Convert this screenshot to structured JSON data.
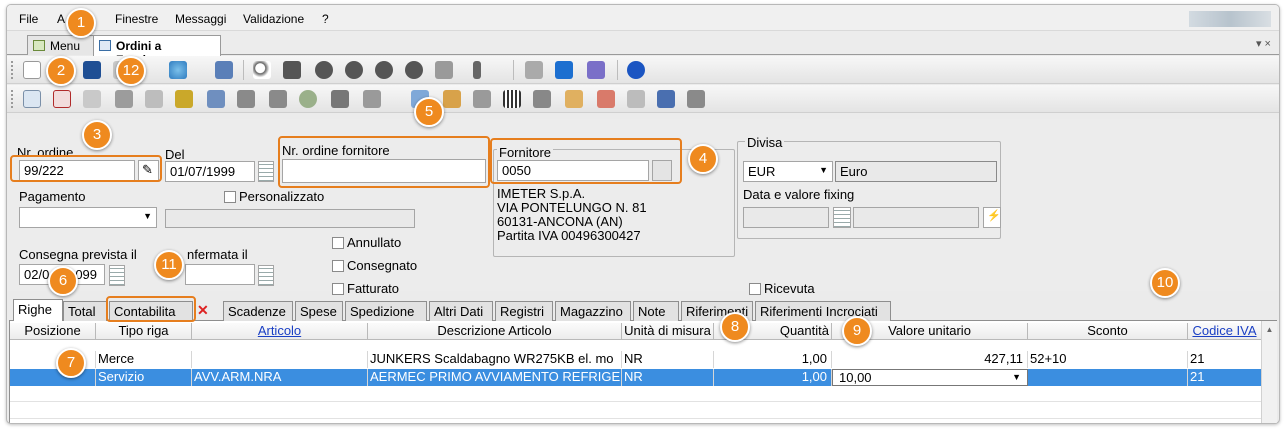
{
  "menu": {
    "file": "File",
    "a": "A",
    "finestre": "Finestre",
    "messaggi": "Messaggi",
    "validazione": "Validazione",
    "help": "?"
  },
  "tabs": {
    "menu": "Menu",
    "ordini": "Ordini a Fornitore"
  },
  "window_controls": "▾ ×",
  "badges": [
    "1",
    "2",
    "3",
    "4",
    "5",
    "6",
    "7",
    "8",
    "9",
    "10",
    "11",
    "12"
  ],
  "form": {
    "nr_ordine_label": "Nr. ordine",
    "nr_ordine": "99/222",
    "del_label": "Del",
    "del": "01/07/1999",
    "nr_ordine_fornitore_label": "Nr. ordine fornitore",
    "nr_ordine_fornitore": "",
    "fornitore_label": "Fornitore",
    "fornitore": "0050",
    "fornitore_info": [
      "IMETER S.p.A.",
      "VIA PONTELUNGO N. 81",
      "60131-ANCONA (AN)",
      "Partita IVA 00496300427"
    ],
    "divisa_label": "Divisa",
    "divisa_code": "EUR",
    "divisa_name": "Euro",
    "fixing_label": "Data e valore fixing",
    "pagamento_label": "Pagamento",
    "pagamento": "",
    "personalizzato_label": "Personalizzato",
    "consegna_prevista_label": "Consegna prevista il",
    "consegna_prevista": "02/0",
    "consegna_prevista_tail": "099",
    "confermata_label": "nfermata il",
    "confermata": "",
    "annullato_label": "Annullato",
    "consegnato_label": "Consegnato",
    "fatturato_label": "Fatturato",
    "ricevuta_label": "Ricevuta"
  },
  "content_tabs": [
    "Righe",
    "Total",
    "Contabilita",
    "Scadenze",
    "Spese",
    "Spedizione",
    "Altri Dati",
    "Registri",
    "Magazzino",
    "Note",
    "Riferimenti",
    "Riferimenti Incrociati"
  ],
  "grid": {
    "headers": [
      "Posizione",
      "Tipo riga",
      "Articolo",
      "Descrizione Articolo",
      "Unità di misura",
      "Quantità",
      "Valore unitario",
      "Sconto",
      "Codice IVA"
    ],
    "rows": [
      {
        "posizione": "",
        "tipo": "Merce",
        "articolo": "",
        "descrizione": "JUNKERS Scaldabagno WR275KB el. mo",
        "um": "NR",
        "quantita": "1,00",
        "valore": "427,11",
        "sconto": "52+10",
        "iva": "21"
      },
      {
        "posizione": "",
        "tipo": "Servizio",
        "articolo": "AVV.ARM.NRA",
        "descrizione": "AERMEC PRIMO AVVIAMENTO REFRIGER",
        "um": "NR",
        "quantita": "1,00",
        "valore": "10,00",
        "sconto": "",
        "iva": "21"
      }
    ]
  },
  "colors": {
    "highlight": "#e67e1e",
    "badge": "#ef8a1f",
    "selection": "#3b8ee0"
  }
}
